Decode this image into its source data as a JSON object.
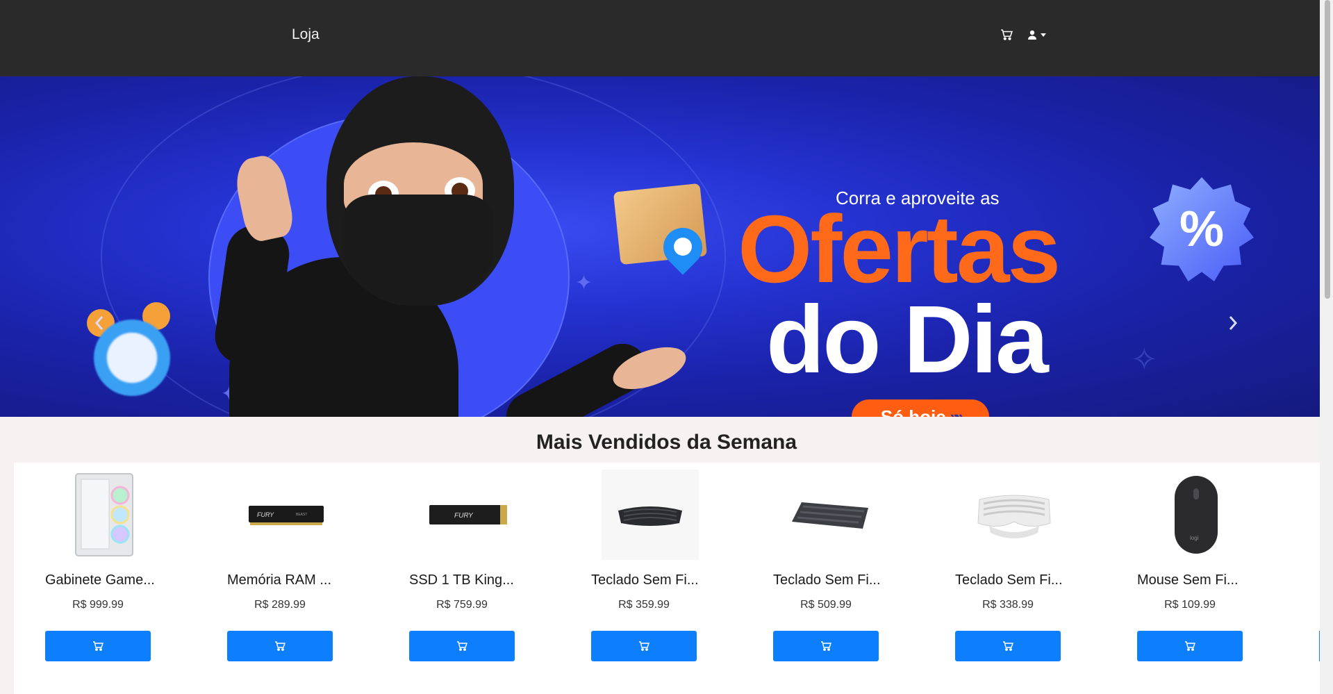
{
  "navbar": {
    "brand": "Loja",
    "icons": [
      "cart-icon",
      "user-icon",
      "caret-down-icon"
    ]
  },
  "hero": {
    "tagline": "Corra e aproveite as",
    "title_line1": "Ofertas",
    "title_line2": "do Dia",
    "cta_label": "Só hoje",
    "badge_symbol": "%",
    "slides": 3,
    "active_slide": 1,
    "colors": {
      "background": "#2432d0",
      "accent": "#ff6a1a",
      "badge": "#4a5cf7"
    }
  },
  "section": {
    "title": "Mais Vendidos da Semana"
  },
  "products": [
    {
      "name": "Gabinete Game...",
      "price": "R$ 999.99",
      "image": "pc-case-image"
    },
    {
      "name": "Memória RAM ...",
      "price": "R$ 289.99",
      "image": "ram-module-image"
    },
    {
      "name": "SSD 1 TB King...",
      "price": "R$ 759.99",
      "image": "ssd-image"
    },
    {
      "name": "Teclado Sem Fi...",
      "price": "R$ 359.99",
      "image": "ergonomic-keyboard-image"
    },
    {
      "name": "Teclado Sem Fi...",
      "price": "R$ 509.99",
      "image": "compact-keyboard-image"
    },
    {
      "name": "Teclado Sem Fi...",
      "price": "R$ 338.99",
      "image": "white-keyboard-image"
    },
    {
      "name": "Mouse Sem Fi...",
      "price": "R$ 109.99",
      "image": "mouse-image"
    }
  ],
  "colors": {
    "navbar": "#2a2a2a",
    "page_background": "#f6f2f1",
    "button": "#0d7efc"
  }
}
